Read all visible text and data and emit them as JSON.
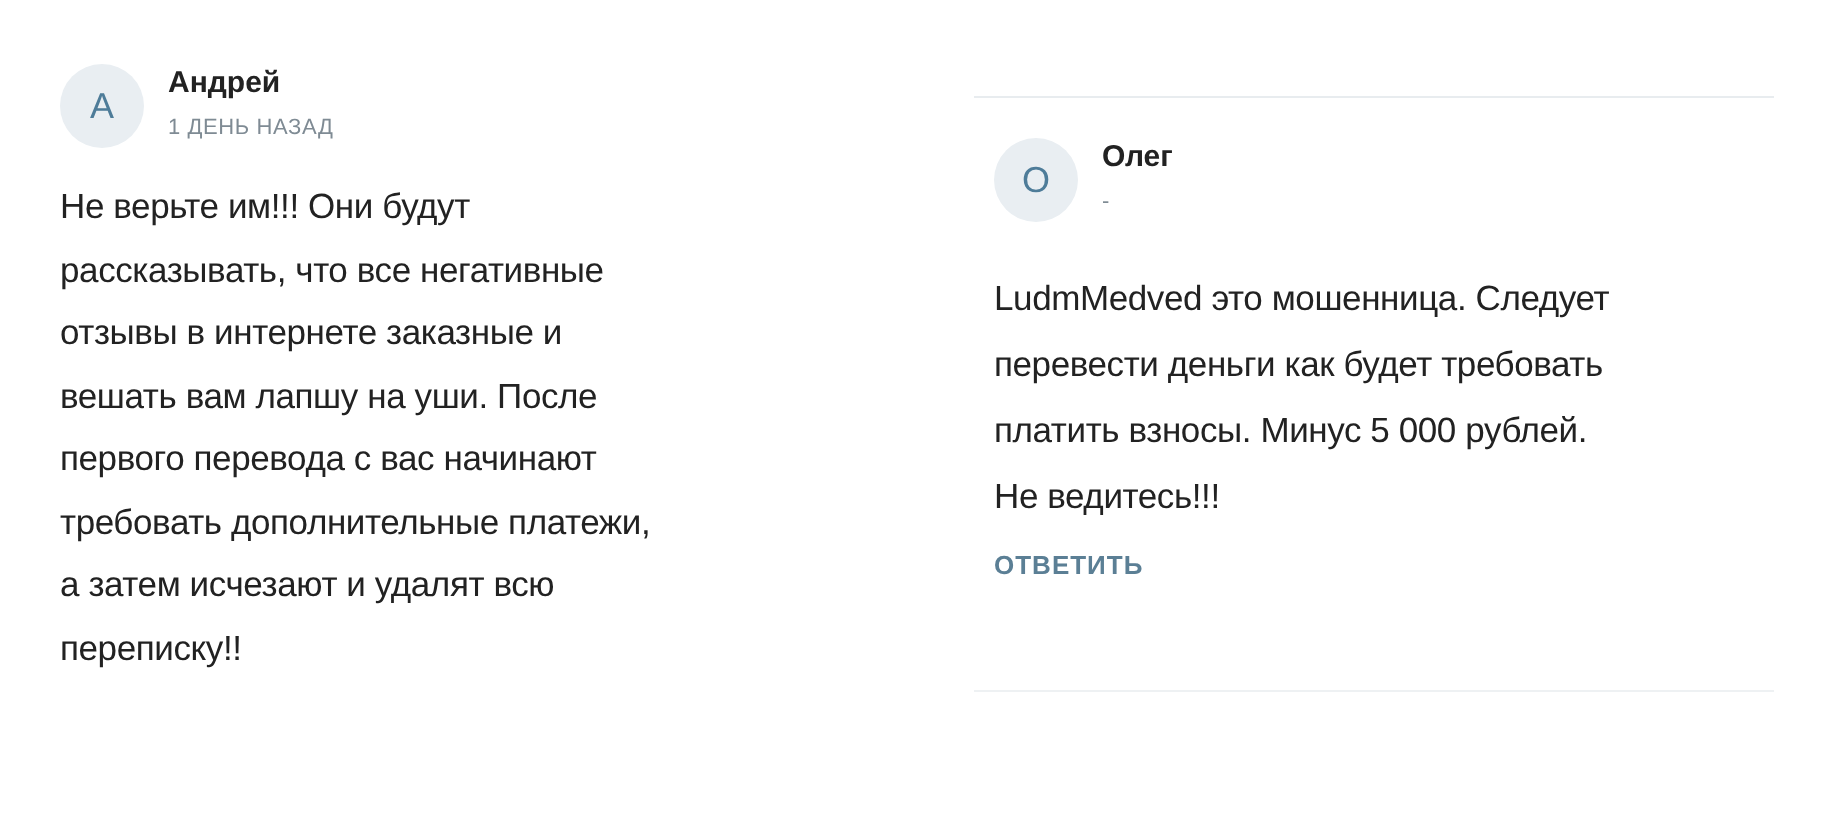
{
  "comments": [
    {
      "avatar": "А",
      "author": "Андрей",
      "time": "1 ДЕНЬ НАЗАД",
      "lines": [
        "Не верьте им!!! Они будут",
        "рассказывать, что все негативные",
        "отзывы в интернете заказные и",
        "вешать вам лапшу на уши. После",
        "первого перевода с вас начинают",
        "требовать дополнительные платежи,",
        "а затем исчезают и удалят всю",
        "переписку!!"
      ]
    },
    {
      "avatar": "О",
      "author": "Олег",
      "time": "-",
      "lines": [
        "LudmMedved это мошенница. Следует",
        "перевести деньги как будет требовать",
        "платить взносы. Минус 5 000 рублей.",
        "Не ведитесь!!!"
      ],
      "reply": "ОТВЕТИТЬ"
    }
  ]
}
